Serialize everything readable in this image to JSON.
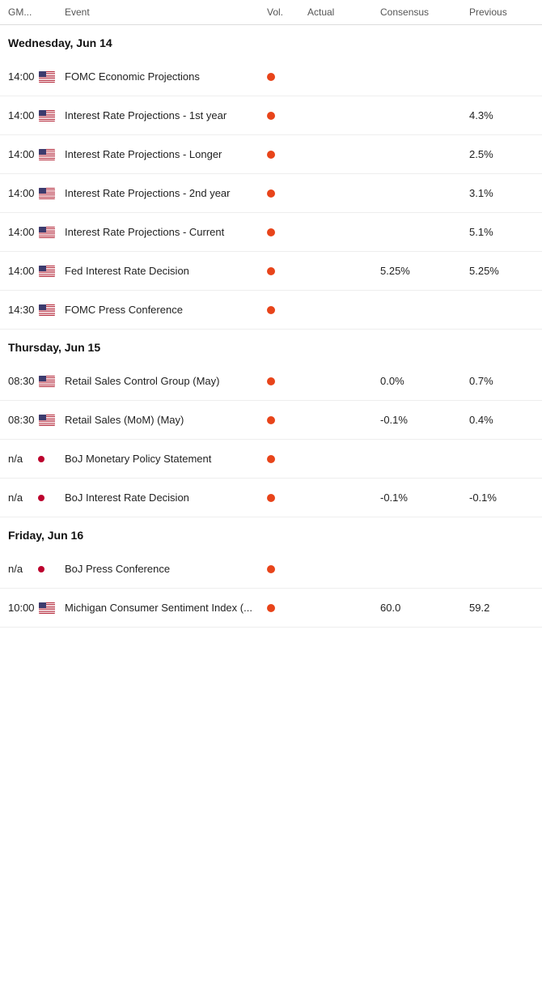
{
  "header": {
    "gmt": "GM...",
    "event": "Event",
    "vol": "Vol.",
    "actual": "Actual",
    "consensus": "Consensus",
    "previous": "Previous"
  },
  "sections": [
    {
      "title": "Wednesday, Jun 14",
      "events": [
        {
          "time": "14:00",
          "flag": "us",
          "name": "FOMC Economic Projections",
          "vol": true,
          "actual": "",
          "consensus": "",
          "previous": ""
        },
        {
          "time": "14:00",
          "flag": "us",
          "name": "Interest Rate Projections - 1st year",
          "vol": true,
          "actual": "",
          "consensus": "",
          "previous": "4.3%"
        },
        {
          "time": "14:00",
          "flag": "us",
          "name": "Interest Rate Projections - Longer",
          "vol": true,
          "actual": "",
          "consensus": "",
          "previous": "2.5%"
        },
        {
          "time": "14:00",
          "flag": "us",
          "name": "Interest Rate Projections - 2nd year",
          "vol": true,
          "actual": "",
          "consensus": "",
          "previous": "3.1%"
        },
        {
          "time": "14:00",
          "flag": "us",
          "name": "Interest Rate Projections - Current",
          "vol": true,
          "actual": "",
          "consensus": "",
          "previous": "5.1%"
        },
        {
          "time": "14:00",
          "flag": "us",
          "name": "Fed Interest Rate Decision",
          "vol": true,
          "actual": "",
          "consensus": "5.25%",
          "previous": "5.25%"
        },
        {
          "time": "14:30",
          "flag": "us",
          "name": "FOMC Press Conference",
          "vol": true,
          "actual": "",
          "consensus": "",
          "previous": ""
        }
      ]
    },
    {
      "title": "Thursday, Jun 15",
      "events": [
        {
          "time": "08:30",
          "flag": "us",
          "name": "Retail Sales Control Group (May)",
          "vol": true,
          "actual": "",
          "consensus": "0.0%",
          "previous": "0.7%"
        },
        {
          "time": "08:30",
          "flag": "us",
          "name": "Retail Sales (MoM) (May)",
          "vol": true,
          "actual": "",
          "consensus": "-0.1%",
          "previous": "0.4%"
        },
        {
          "time": "n/a",
          "flag": "jp",
          "name": "BoJ Monetary Policy Statement",
          "vol": true,
          "actual": "",
          "consensus": "",
          "previous": ""
        },
        {
          "time": "n/a",
          "flag": "jp",
          "name": "BoJ Interest Rate Decision",
          "vol": true,
          "actual": "",
          "consensus": "-0.1%",
          "previous": "-0.1%"
        }
      ]
    },
    {
      "title": "Friday, Jun 16",
      "events": [
        {
          "time": "n/a",
          "flag": "jp",
          "name": "BoJ Press Conference",
          "vol": true,
          "actual": "",
          "consensus": "",
          "previous": ""
        },
        {
          "time": "10:00",
          "flag": "us",
          "name": "Michigan Consumer Sentiment Index (...",
          "vol": true,
          "actual": "",
          "consensus": "60.0",
          "previous": "59.2"
        }
      ]
    }
  ]
}
